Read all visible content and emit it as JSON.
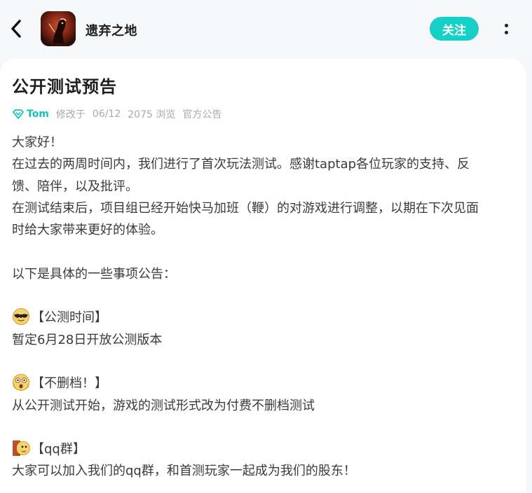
{
  "header": {
    "app_name": "遗弃之地",
    "follow_label": "关注",
    "back_icon": "back-arrow-icon",
    "more_icon": "more-vertical-icon"
  },
  "post": {
    "title": "公开测试预告",
    "author": "Tom",
    "modified": "修改于",
    "date": "06/12",
    "views": "2075 浏览",
    "category": "官方公告",
    "lines": [
      "大家好！",
      "在过去的两周时间内，我们进行了首次玩法测试。感谢taptap各位玩家的支持、反",
      "馈、陪伴，以及批评。",
      "在测试结束后，项目组已经开始快马加班（鞭）的对游戏进行调整，以期在下次见面",
      "时给大家带来更好的体验。",
      "以下是具体的一些事项公告："
    ],
    "sections": [
      {
        "emoji": "sunglasses-emoji",
        "heading": "【公测时间】",
        "body": "暂定6月28日开放公测版本"
      },
      {
        "emoji": "shocked-emoji",
        "heading": "【不删档！】",
        "body": "从公开测试开始，游戏的测试形式改为付费不删档测试"
      },
      {
        "emoji": "peeking-wall-emoji",
        "heading": "【qq群】",
        "body": "大家可以加入我们的qq群，和首测玩家一起成为我们的股东！"
      }
    ]
  },
  "colors": {
    "accent": "#15d0c6",
    "author": "#15c2b6",
    "meta": "#a8a8a8",
    "text": "#3b3b3b"
  }
}
